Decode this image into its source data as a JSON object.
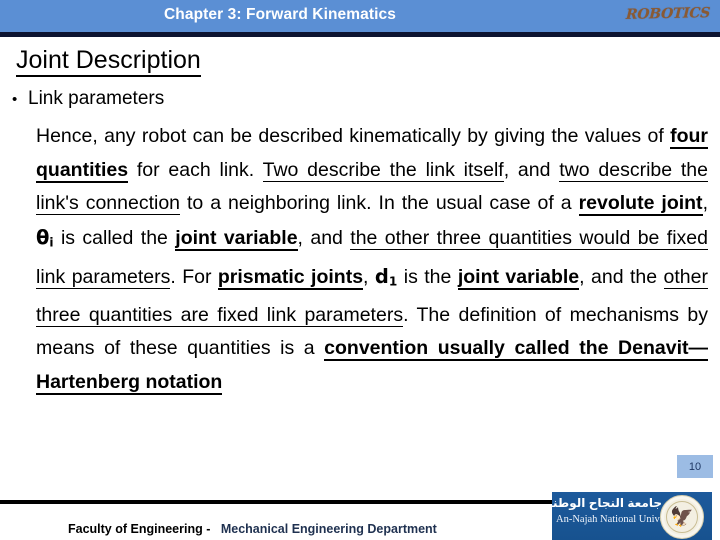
{
  "header": {
    "title": "Chapter 3: Forward Kinematics",
    "logo_text": "ROBOTICS",
    "bar_color": "#5b8fd4",
    "rule_color": "#0d1430",
    "title_color": "#ffffff",
    "logo_color": "#8a5a33"
  },
  "slide": {
    "title": "Joint Description",
    "bullet_marker": "•",
    "bullet_label": "Link parameters",
    "paragraph_segments": [
      {
        "text": "Hence, any robot can be described kinematically by giving the values of ",
        "style": "plain"
      },
      {
        "text": "four quantities",
        "style": "bold-underline"
      },
      {
        "text": " for each link. ",
        "style": "plain"
      },
      {
        "text": "Two describe the link itself",
        "style": "underline"
      },
      {
        "text": ", and ",
        "style": "plain"
      },
      {
        "text": "two describe the link's connection",
        "style": "underline"
      },
      {
        "text": " to a neighboring link. In the usual case of a ",
        "style": "plain"
      },
      {
        "text": "revolute joint",
        "style": "bold-underline"
      },
      {
        "text": ", ",
        "style": "plain"
      },
      {
        "text": "θ",
        "style": "symbol",
        "subscript": "i"
      },
      {
        "text": " is called the ",
        "style": "plain"
      },
      {
        "text": "joint variable",
        "style": "bold-underline"
      },
      {
        "text": ", and ",
        "style": "plain"
      },
      {
        "text": "the other three quantities would be fixed link parameters",
        "style": "underline"
      },
      {
        "text": ". For ",
        "style": "plain"
      },
      {
        "text": "prismatic joints",
        "style": "bold-underline"
      },
      {
        "text": ", ",
        "style": "plain"
      },
      {
        "text": "d",
        "style": "symbol",
        "subscript": "1"
      },
      {
        "text": " is the ",
        "style": "plain"
      },
      {
        "text": "joint variable",
        "style": "bold-underline"
      },
      {
        "text": ", and the ",
        "style": "plain"
      },
      {
        "text": "other three quantities are fixed link parameters",
        "style": "underline"
      },
      {
        "text": ". The definition of mechanisms by means of these quantities is a ",
        "style": "plain"
      },
      {
        "text": "convention usually called the Denavit—Hartenberg notation",
        "style": "bold-underline"
      }
    ]
  },
  "page_number": {
    "value": "10",
    "background": "#9cbce4",
    "text_color": "#1f3864"
  },
  "footer": {
    "text_primary": "Faculty of Engineering -",
    "text_secondary": "Mechanical Engineering Department",
    "primary_color": "#000000",
    "secondary_color": "#1f3150",
    "university_arabic": "جامعة النجاح الوطنية",
    "university_english": "An-Najah National University",
    "logo_background": "#1e5799"
  }
}
